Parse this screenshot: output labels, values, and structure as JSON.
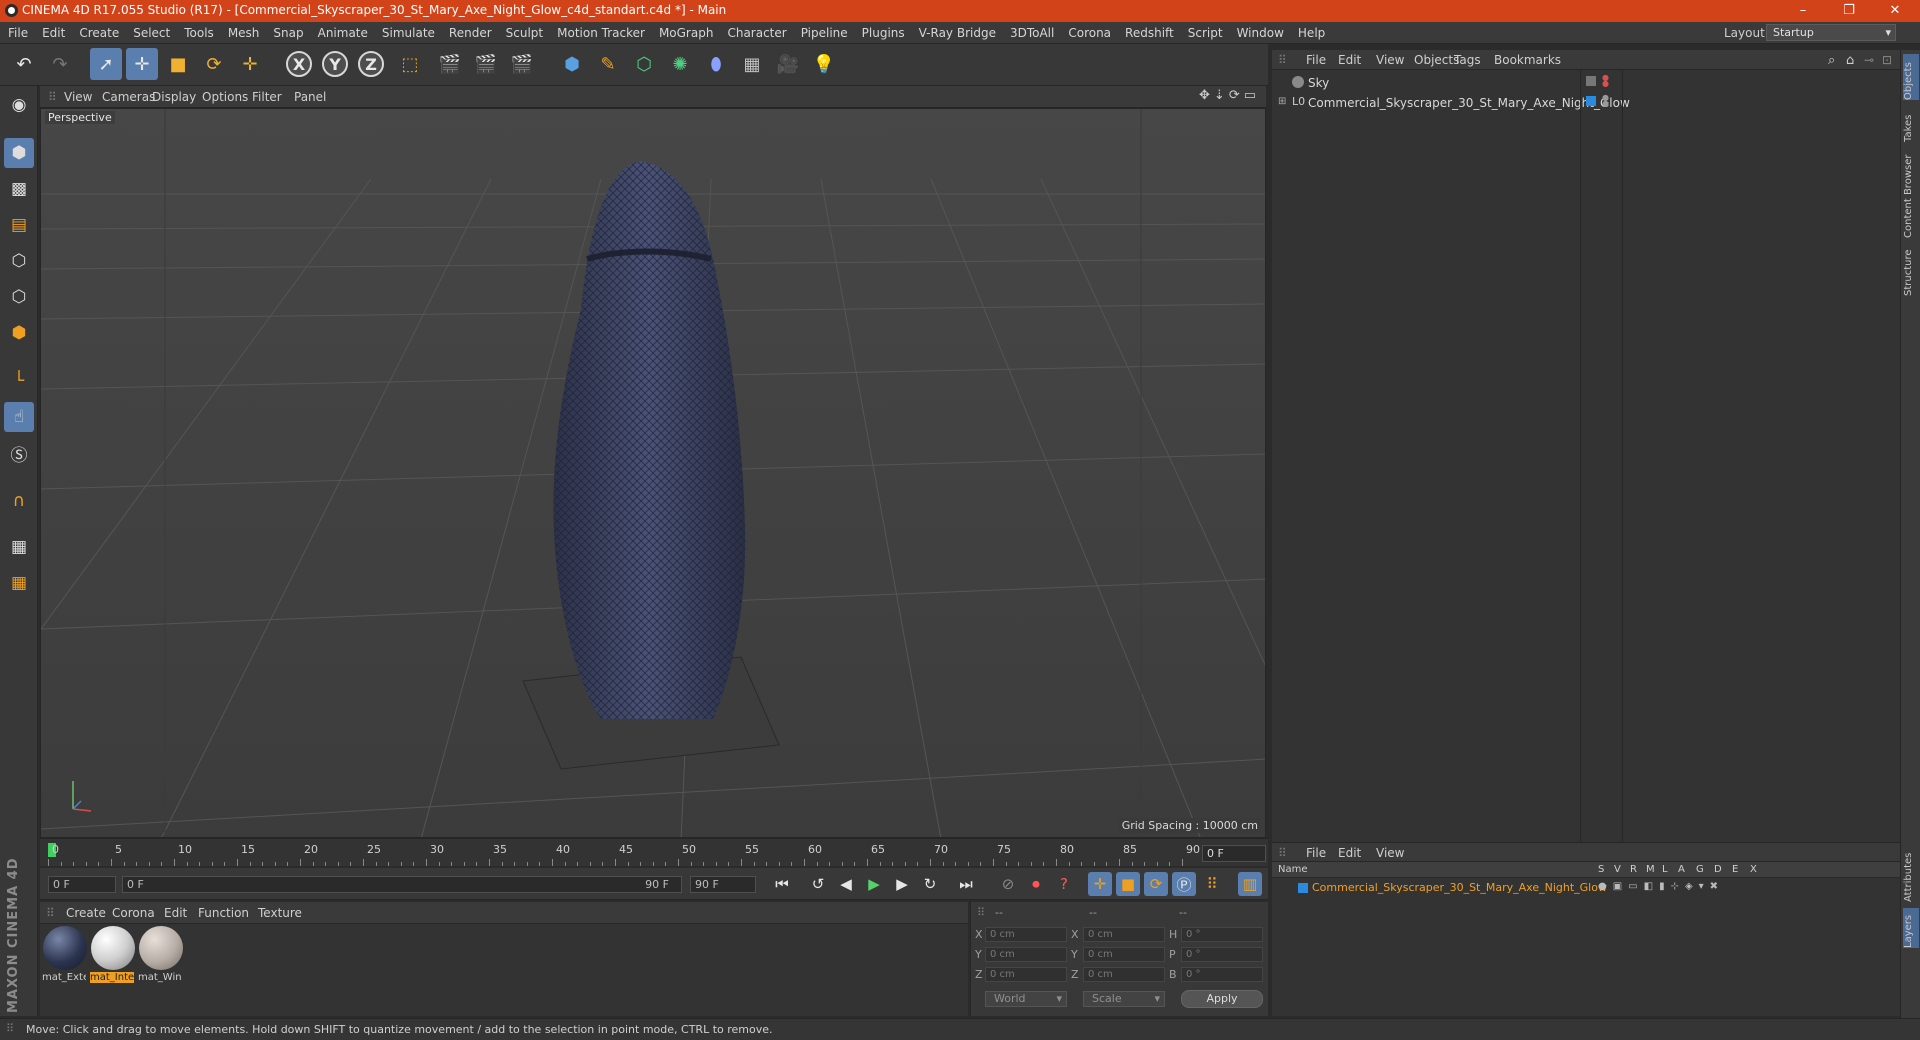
{
  "titlebar": {
    "title": "CINEMA 4D R17.055 Studio (R17) - [Commercial_Skyscraper_30_St_Mary_Axe_Night_Glow_c4d_standart.c4d *] - Main",
    "minimize": "–",
    "restore": "❐",
    "close": "✕"
  },
  "menubar": {
    "items": [
      "File",
      "Edit",
      "Create",
      "Select",
      "Tools",
      "Mesh",
      "Snap",
      "Animate",
      "Simulate",
      "Render",
      "Sculpt",
      "Motion Tracker",
      "MoGraph",
      "Character",
      "Pipeline",
      "Plugins",
      "V-Ray Bridge",
      "3DToAll",
      "Corona",
      "Redshift",
      "Script",
      "Window",
      "Help"
    ],
    "layout_label": "Layout:",
    "layout_value": "Startup"
  },
  "toolbar": {
    "axis_x": "X",
    "axis_y": "Y",
    "axis_z": "Z"
  },
  "viewport": {
    "menu": [
      "View",
      "Cameras",
      "Display",
      "Options",
      "Filter",
      "Panel"
    ],
    "label": "Perspective",
    "grid_spacing": "Grid Spacing : 10000 cm",
    "nav_icons": "✥⇣⟳▭"
  },
  "timeline": {
    "ticks": [
      "0",
      "5",
      "10",
      "15",
      "20",
      "25",
      "30",
      "35",
      "40",
      "45",
      "50",
      "55",
      "60",
      "65",
      "70",
      "75",
      "80",
      "85",
      "90"
    ],
    "current_frame": "0 F",
    "start_field": "0 F",
    "range_start": "0 F",
    "range_end": "90 F",
    "end_field": "90 F"
  },
  "materials": {
    "menu": [
      "Create",
      "Corona",
      "Edit",
      "Function",
      "Texture"
    ],
    "items": [
      {
        "name": "mat_Exte",
        "selected": false,
        "color": "#2c3550"
      },
      {
        "name": "mat_Inte",
        "selected": true,
        "color": "#d9d9d9"
      },
      {
        "name": "mat_Win",
        "selected": false,
        "color": "#b5aca5"
      }
    ]
  },
  "coordinates": {
    "header": [
      "--",
      "--",
      "--"
    ],
    "rows": [
      {
        "a": "X",
        "av": "0 cm",
        "b": "X",
        "bv": "0 cm",
        "c": "H",
        "cv": "0 °"
      },
      {
        "a": "Y",
        "av": "0 cm",
        "b": "Y",
        "bv": "0 cm",
        "c": "P",
        "cv": "0 °"
      },
      {
        "a": "Z",
        "av": "0 cm",
        "b": "Z",
        "bv": "0 cm",
        "c": "B",
        "cv": "0 °"
      }
    ],
    "world": "World",
    "scale": "Scale",
    "apply": "Apply"
  },
  "status": "Move: Click and drag to move elements. Hold down SHIFT to quantize movement / add to the selection in point mode, CTRL to remove.",
  "objects": {
    "menu": [
      "File",
      "Edit",
      "View",
      "Objects",
      "Tags",
      "Bookmarks"
    ],
    "rows": [
      {
        "name": "Sky"
      },
      {
        "name": "Commercial_Skyscraper_30_St_Mary_Axe_Night_Glow"
      }
    ]
  },
  "right_tabs": [
    "Objects",
    "Takes",
    "Content Browser",
    "Structure",
    "Attributes",
    "Layers"
  ],
  "layers": {
    "menu": [
      "File",
      "Edit",
      "View"
    ],
    "headers": [
      "Name",
      "S",
      "V",
      "R",
      "M",
      "L",
      "A",
      "G",
      "D",
      "E",
      "X"
    ],
    "row_name": "Commercial_Skyscraper_30_St_Mary_Axe_Night_Glow",
    "accent": "#f0a020"
  },
  "brand": "MAXON CINEMA 4D"
}
